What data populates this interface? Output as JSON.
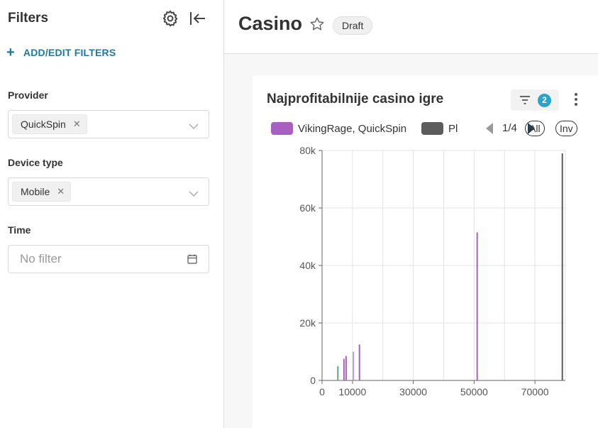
{
  "filters": {
    "title": "Filters",
    "add_label": "ADD/EDIT FILTERS",
    "provider": {
      "label": "Provider",
      "tag": "QuickSpin"
    },
    "device": {
      "label": "Device type",
      "tag": "Mobile"
    },
    "time": {
      "label": "Time",
      "placeholder": "No filter"
    }
  },
  "dashboard": {
    "title": "Casino",
    "status": "Draft"
  },
  "card": {
    "title": "Najprofitabilnije casino igre",
    "filter_count": "2",
    "legend": {
      "items": [
        {
          "label": "VikingRage, QuickSpin",
          "color": "#a95fbf"
        },
        {
          "label": "Pl",
          "color": "#5c5c5c"
        }
      ],
      "page": "1/4",
      "all_label": "All",
      "inv_label": "Inv"
    }
  },
  "chart_data": {
    "type": "bar",
    "x_ticks": [
      "0",
      "10000",
      "30000",
      "50000",
      "70000"
    ],
    "y_ticks": [
      "0",
      "20k",
      "40k",
      "60k",
      "80k"
    ],
    "xlim": [
      0,
      80000
    ],
    "ylim": [
      0,
      80000
    ],
    "grid": true,
    "bars": [
      {
        "x": 5200,
        "y": 5000,
        "color": "#5aa97a"
      },
      {
        "x": 7200,
        "y": 7500,
        "color": "#a95fbf"
      },
      {
        "x": 7900,
        "y": 8500,
        "color": "#a95fbf"
      },
      {
        "x": 10300,
        "y": 10000,
        "color": "#a9a3d9"
      },
      {
        "x": 12300,
        "y": 12500,
        "color": "#a95fbf"
      },
      {
        "x": 51000,
        "y": 51500,
        "color": "#a95fbf"
      },
      {
        "x": 79000,
        "y": 79000,
        "color": "#5c5c5c"
      }
    ]
  }
}
